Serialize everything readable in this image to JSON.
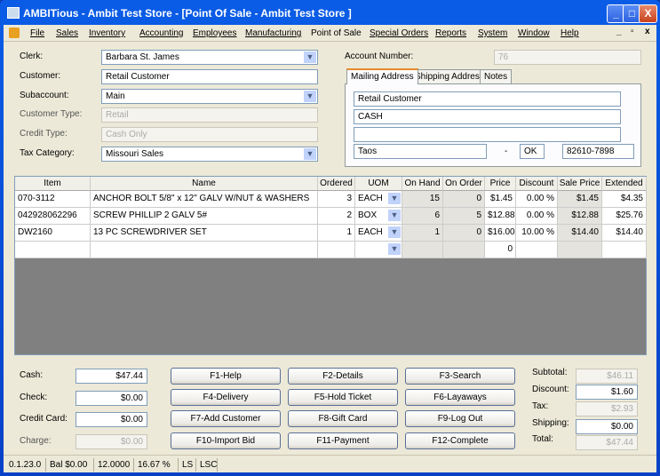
{
  "window": {
    "title": "AMBITious - Ambit Test Store - [Point Of Sale - Ambit Test Store          ]",
    "min": "_",
    "max": "□",
    "close": "X"
  },
  "menu": {
    "items": [
      "File",
      "Sales",
      "Inventory",
      "Accounting",
      "Employees",
      "Manufacturing",
      "Point of Sale",
      "Special Orders",
      "Reports",
      "System",
      "Window",
      "Help"
    ],
    "mdi_min": "_",
    "mdi_restore": "▫",
    "mdi_close": "x"
  },
  "form": {
    "clerk": {
      "label": "Clerk:",
      "value": "Barbara St. James"
    },
    "customer": {
      "label": "Customer:",
      "value": "Retail Customer"
    },
    "subaccount": {
      "label": "Subaccount:",
      "value": "Main"
    },
    "customer_type": {
      "label": "Customer Type:",
      "value": "Retail"
    },
    "credit_type": {
      "label": "Credit Type:",
      "value": "Cash Only"
    },
    "tax_category": {
      "label": "Tax Category:",
      "value": "Missouri Sales"
    },
    "account_number": {
      "label": "Account Number:",
      "value": "76"
    }
  },
  "address": {
    "tabs": [
      "Mailing Address",
      "Shipping Address",
      "Notes"
    ],
    "line1": "Retail Customer",
    "line2": "CASH",
    "line3": "",
    "city": "Taos",
    "dash": "-",
    "state": "OK",
    "zip": "82610-7898"
  },
  "grid": {
    "headers": [
      "Item",
      "Name",
      "Ordered",
      "UOM",
      "On Hand",
      "On Order",
      "Price",
      "Discount",
      "Sale Price",
      "Extended"
    ],
    "rows": [
      [
        "070-3112",
        "ANCHOR BOLT 5/8\" x 12\" GALV  W/NUT & WASHERS",
        "3",
        "EACH",
        "15",
        "0",
        "$1.45",
        "0.00 %",
        "$1.45",
        "$4.35"
      ],
      [
        "042928062296",
        "SCREW PHILLIP 2 GALV 5#",
        "2",
        "BOX",
        "6",
        "5",
        "$12.88",
        "0.00 %",
        "$12.88",
        "$25.76"
      ],
      [
        "DW2160",
        "13 PC SCREWDRIVER SET",
        "1",
        "EACH",
        "1",
        "0",
        "$16.00",
        "10.00 %",
        "$14.40",
        "$14.40"
      ],
      [
        "",
        "",
        "",
        "",
        "",
        "",
        "0",
        "",
        "",
        ""
      ]
    ]
  },
  "payments": [
    {
      "label": "Cash:",
      "value": "$47.44"
    },
    {
      "label": "Check:",
      "value": "$0.00"
    },
    {
      "label": "Credit Card:",
      "value": "$0.00"
    },
    {
      "label": "Charge:",
      "value": "$0.00"
    }
  ],
  "buttons": [
    "F1-Help",
    "F2-Details",
    "F3-Search",
    "F4-Delivery",
    "F5-Hold Ticket",
    "F6-Layaways",
    "F7-Add Customer",
    "F8-Gift Card",
    "F9-Log Out",
    "F10-Import Bid",
    "F11-Payment",
    "F12-Complete"
  ],
  "totals": [
    {
      "label": "Subtotal:",
      "value": "$46.11"
    },
    {
      "label": "Discount:",
      "value": "$1.60"
    },
    {
      "label": "Tax:",
      "value": "$2.93"
    },
    {
      "label": "Shipping:",
      "value": "$0.00"
    },
    {
      "label": "Total:",
      "value": "$47.44"
    }
  ],
  "status": [
    "0.1.23.0",
    "Bal $0.00",
    "12.0000",
    "16.67 %",
    "LS",
    "LSC"
  ]
}
